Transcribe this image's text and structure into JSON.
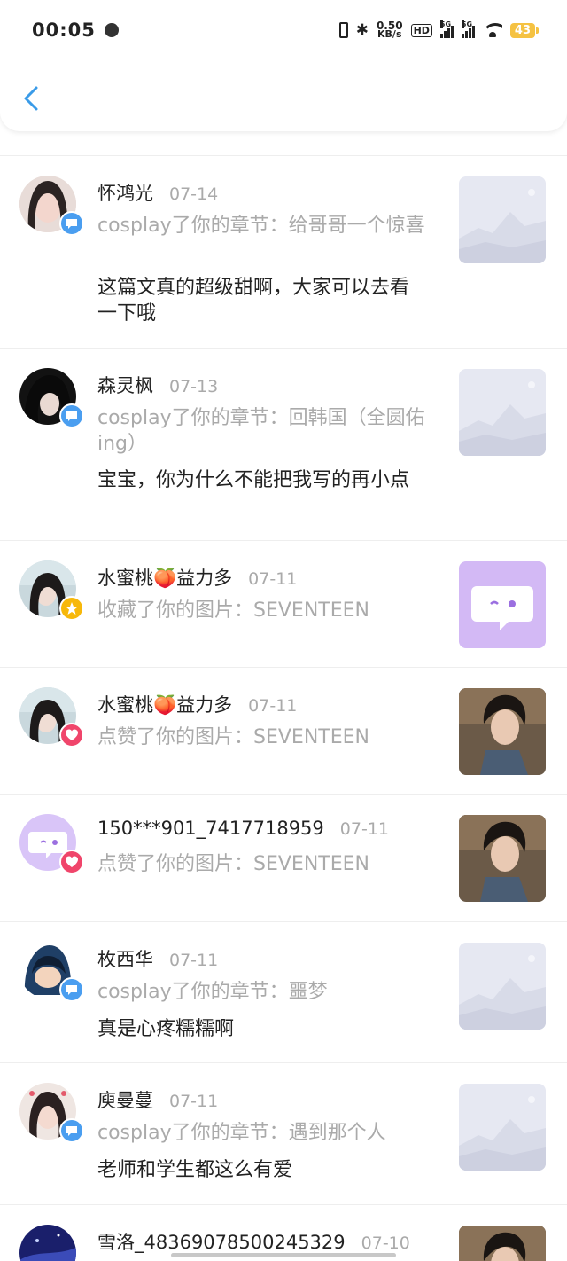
{
  "status": {
    "time": "00:05",
    "net_speed_value": "0.50",
    "net_speed_unit": "KB/s",
    "hd_label": "HD",
    "signal_label_1": "5G",
    "signal_label_2": "5G",
    "battery": "43"
  },
  "partial_text": "",
  "items": [
    {
      "name": "怀鸿光",
      "date": "07-14",
      "action": "cosplay了你的章节：给哥哥一个惊喜",
      "comment": "这篇文真的超级甜啊，大家可以去看一下哦",
      "badge": "comment-icon",
      "thumb": "placeholder-image"
    },
    {
      "name": "森灵枫",
      "date": "07-13",
      "action": "cosplay了你的章节：回韩国（全圆佑ing）",
      "comment": "宝宝，你为什么不能把我写的再小点",
      "badge": "comment-icon",
      "thumb": "placeholder-image"
    },
    {
      "name": "水蜜桃🍑益力多",
      "date": "07-11",
      "action": "收藏了你的图片：SEVENTEEN",
      "comment": "",
      "badge": "star-icon",
      "thumb": "purple-chat-logo"
    },
    {
      "name": "水蜜桃🍑益力多",
      "date": "07-11",
      "action": "点赞了你的图片：SEVENTEEN",
      "comment": "",
      "badge": "heart-icon",
      "thumb": "person-photo"
    },
    {
      "name": "150***901_7417718959",
      "date": "07-11",
      "action": "点赞了你的图片：SEVENTEEN",
      "comment": "",
      "badge": "heart-icon",
      "thumb": "person-photo"
    },
    {
      "name": "枚西华",
      "date": "07-11",
      "action": "cosplay了你的章节：噩梦",
      "comment": "真是心疼糯糯啊",
      "badge": "comment-icon",
      "thumb": "placeholder-image"
    },
    {
      "name": "庾曼蔓",
      "date": "07-11",
      "action": "cosplay了你的章节：遇到那个人",
      "comment": "老师和学生都这么有爱",
      "badge": "comment-icon",
      "thumb": "placeholder-image"
    },
    {
      "name": "雪洛_48369078500245329",
      "date": "07-10",
      "action": "",
      "comment": "",
      "badge": "comment-icon",
      "thumb": "person-photo"
    }
  ],
  "colors": {
    "comment_badge": "#4a9ef0",
    "star_badge": "#f7b80a",
    "like_badge": "#f0456b",
    "back_arrow": "#3a9be8"
  }
}
